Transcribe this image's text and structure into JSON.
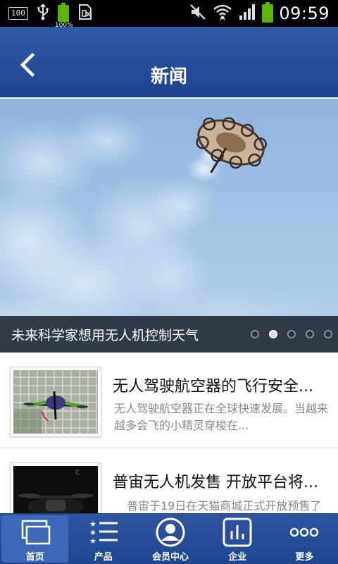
{
  "status_bar": {
    "left_badge": "100",
    "battery_small_label": "100%",
    "time": "09:59"
  },
  "header": {
    "title": "新闻",
    "back_icon": "back-arrow-icon"
  },
  "banner": {
    "title": "未来科学家想用无人机控制天气",
    "dots": 5,
    "active_dot": 1
  },
  "news": [
    {
      "title": "无人驾驶航空器的飞行安全...",
      "desc": "无人驾驶航空器正在全球快速发展。当越来越多会飞的小精灵穿梭在..."
    },
    {
      "title": "普宙无人机发售 开放平台将...",
      "desc": "普宙于19日在天猫商城正式开放预售了"
    }
  ],
  "tabs": [
    {
      "label": "首页",
      "icon": "home-windows-icon",
      "active": true
    },
    {
      "label": "产品",
      "icon": "list-stars-icon",
      "active": false
    },
    {
      "label": "会员中心",
      "icon": "user-icon",
      "active": false
    },
    {
      "label": "企业",
      "icon": "chart-icon",
      "active": false
    },
    {
      "label": "更多",
      "icon": "more-dots-icon",
      "active": false
    }
  ],
  "colors": {
    "header_blue": "#2f5aa6",
    "tab_blue": "#2c56a3",
    "battery_green": "#5fb400"
  }
}
